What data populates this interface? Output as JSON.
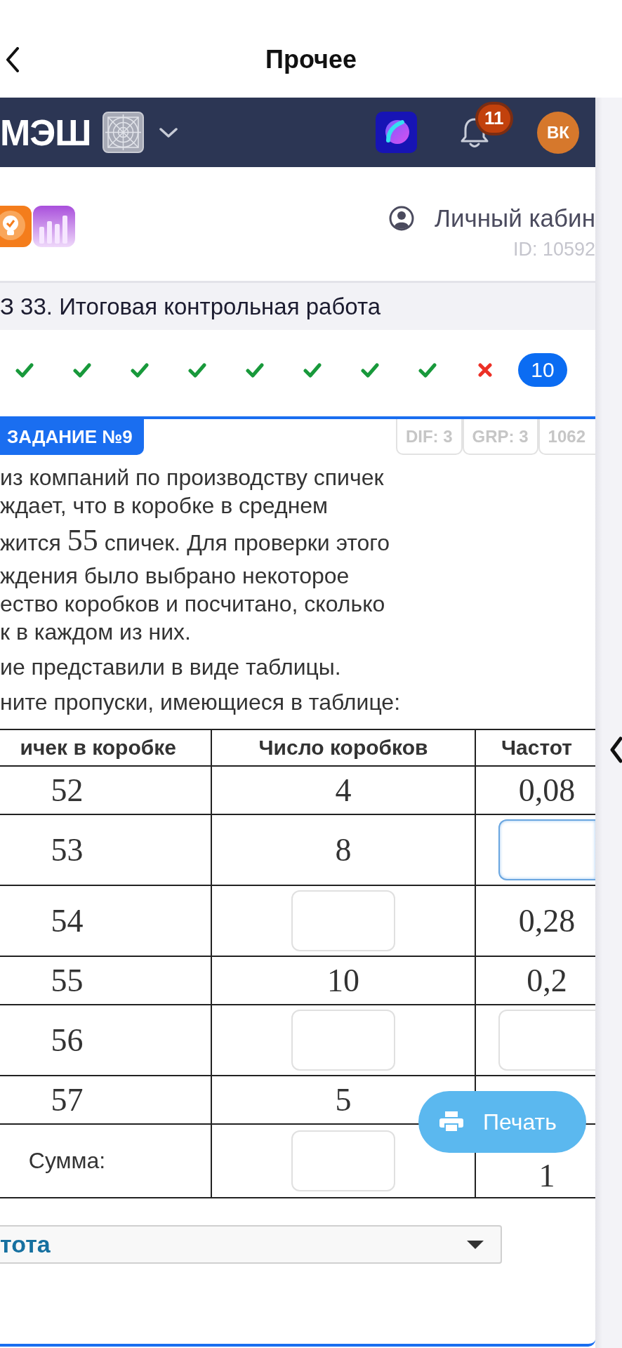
{
  "nav": {
    "title": "Прочее"
  },
  "app_bar": {
    "logo": "МЭШ",
    "notification_count": "11",
    "avatar_initials": "ВК"
  },
  "profile": {
    "link_label": "Личный кабин",
    "user_id": "ID: 10592"
  },
  "assignment_title": "З 33. Итоговая контрольная работа",
  "progress": [
    {
      "kind": "correct",
      "selected": false
    },
    {
      "kind": "correct",
      "selected": false
    },
    {
      "kind": "correct",
      "selected": false
    },
    {
      "kind": "correct",
      "selected": false
    },
    {
      "kind": "correct",
      "selected": false
    },
    {
      "kind": "correct",
      "selected": false
    },
    {
      "kind": "correct",
      "selected": false
    },
    {
      "kind": "correct",
      "selected": false
    },
    {
      "kind": "wrong",
      "selected": false
    },
    {
      "kind": "number",
      "label": "10",
      "selected": true
    }
  ],
  "task": {
    "badge": "ЗАДАНИЕ №9",
    "chips": [
      "DIF: 3",
      "GRP: 3",
      "1062"
    ],
    "paragraphs": [
      {
        "lines": [
          [
            {
              "kind": "text",
              "text": "из компаний по производству спичек"
            }
          ],
          [
            {
              "kind": "text",
              "text": "ждает, что в коробке в среднем"
            }
          ],
          [
            {
              "kind": "text",
              "text": "жится "
            },
            {
              "kind": "math",
              "text": "55"
            },
            {
              "kind": "text",
              "text": " спичек. Для проверки этого"
            }
          ],
          [
            {
              "kind": "text",
              "text": "ждения было выбрано некоторое"
            }
          ],
          [
            {
              "kind": "text",
              "text": "ество коробков и посчитано, сколько"
            }
          ],
          [
            {
              "kind": "text",
              "text": "к в каждом из них."
            }
          ]
        ]
      },
      {
        "lines": [
          [
            {
              "kind": "text",
              "text": "ие представили в виде таблицы."
            }
          ]
        ]
      },
      {
        "lines": [
          [
            {
              "kind": "text",
              "text": "ните пропуски, имеющиеся в таблице:"
            }
          ]
        ]
      }
    ]
  },
  "table": {
    "columns": [
      "ичек в коробке",
      "Число коробков",
      "Частот"
    ],
    "rows": [
      {
        "kind": "data",
        "cells": [
          {
            "kind": "number",
            "text": "52"
          },
          {
            "kind": "number",
            "text": "4"
          },
          {
            "kind": "number",
            "text": "0,08"
          }
        ]
      },
      {
        "kind": "data",
        "cells": [
          {
            "kind": "number",
            "text": "53"
          },
          {
            "kind": "number",
            "text": "8"
          },
          {
            "kind": "input",
            "focused": true
          }
        ]
      },
      {
        "kind": "data",
        "cells": [
          {
            "kind": "number",
            "text": "54"
          },
          {
            "kind": "input",
            "focused": false
          },
          {
            "kind": "number",
            "text": "0,28"
          }
        ]
      },
      {
        "kind": "data",
        "cells": [
          {
            "kind": "number",
            "text": "55"
          },
          {
            "kind": "number",
            "text": "10"
          },
          {
            "kind": "number",
            "text": "0,2"
          }
        ]
      },
      {
        "kind": "data",
        "cells": [
          {
            "kind": "number",
            "text": "56"
          },
          {
            "kind": "input",
            "focused": false
          },
          {
            "kind": "input",
            "focused": false
          }
        ]
      },
      {
        "kind": "data",
        "cells": [
          {
            "kind": "number",
            "text": "57"
          },
          {
            "kind": "number",
            "text": "5"
          },
          {
            "kind": "blank"
          }
        ]
      },
      {
        "kind": "total",
        "cells": [
          {
            "kind": "label",
            "text": "Сумма:"
          },
          {
            "kind": "input",
            "focused": false
          },
          {
            "kind": "number",
            "text": "1"
          }
        ]
      }
    ]
  },
  "print_button": {
    "label": "Печать"
  },
  "dropdown": {
    "value": "тота"
  }
}
